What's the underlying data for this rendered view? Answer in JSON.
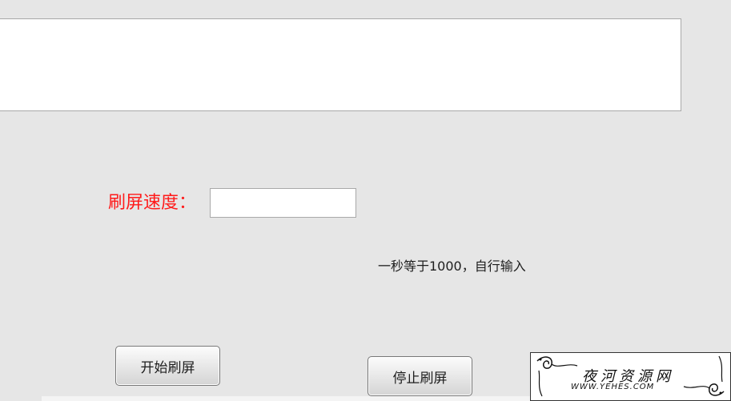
{
  "speed": {
    "label": "刷屏速度：",
    "value": "",
    "hint": "一秒等于1000，自行输入"
  },
  "buttons": {
    "start_label": "开始刷屏",
    "stop_label": "停止刷屏"
  },
  "watermark": {
    "site_name": "夜河资源网",
    "url": "WWW.YEHES.COM"
  },
  "colors": {
    "background": "#e6e6e6",
    "label_red": "#ff1a1a"
  }
}
